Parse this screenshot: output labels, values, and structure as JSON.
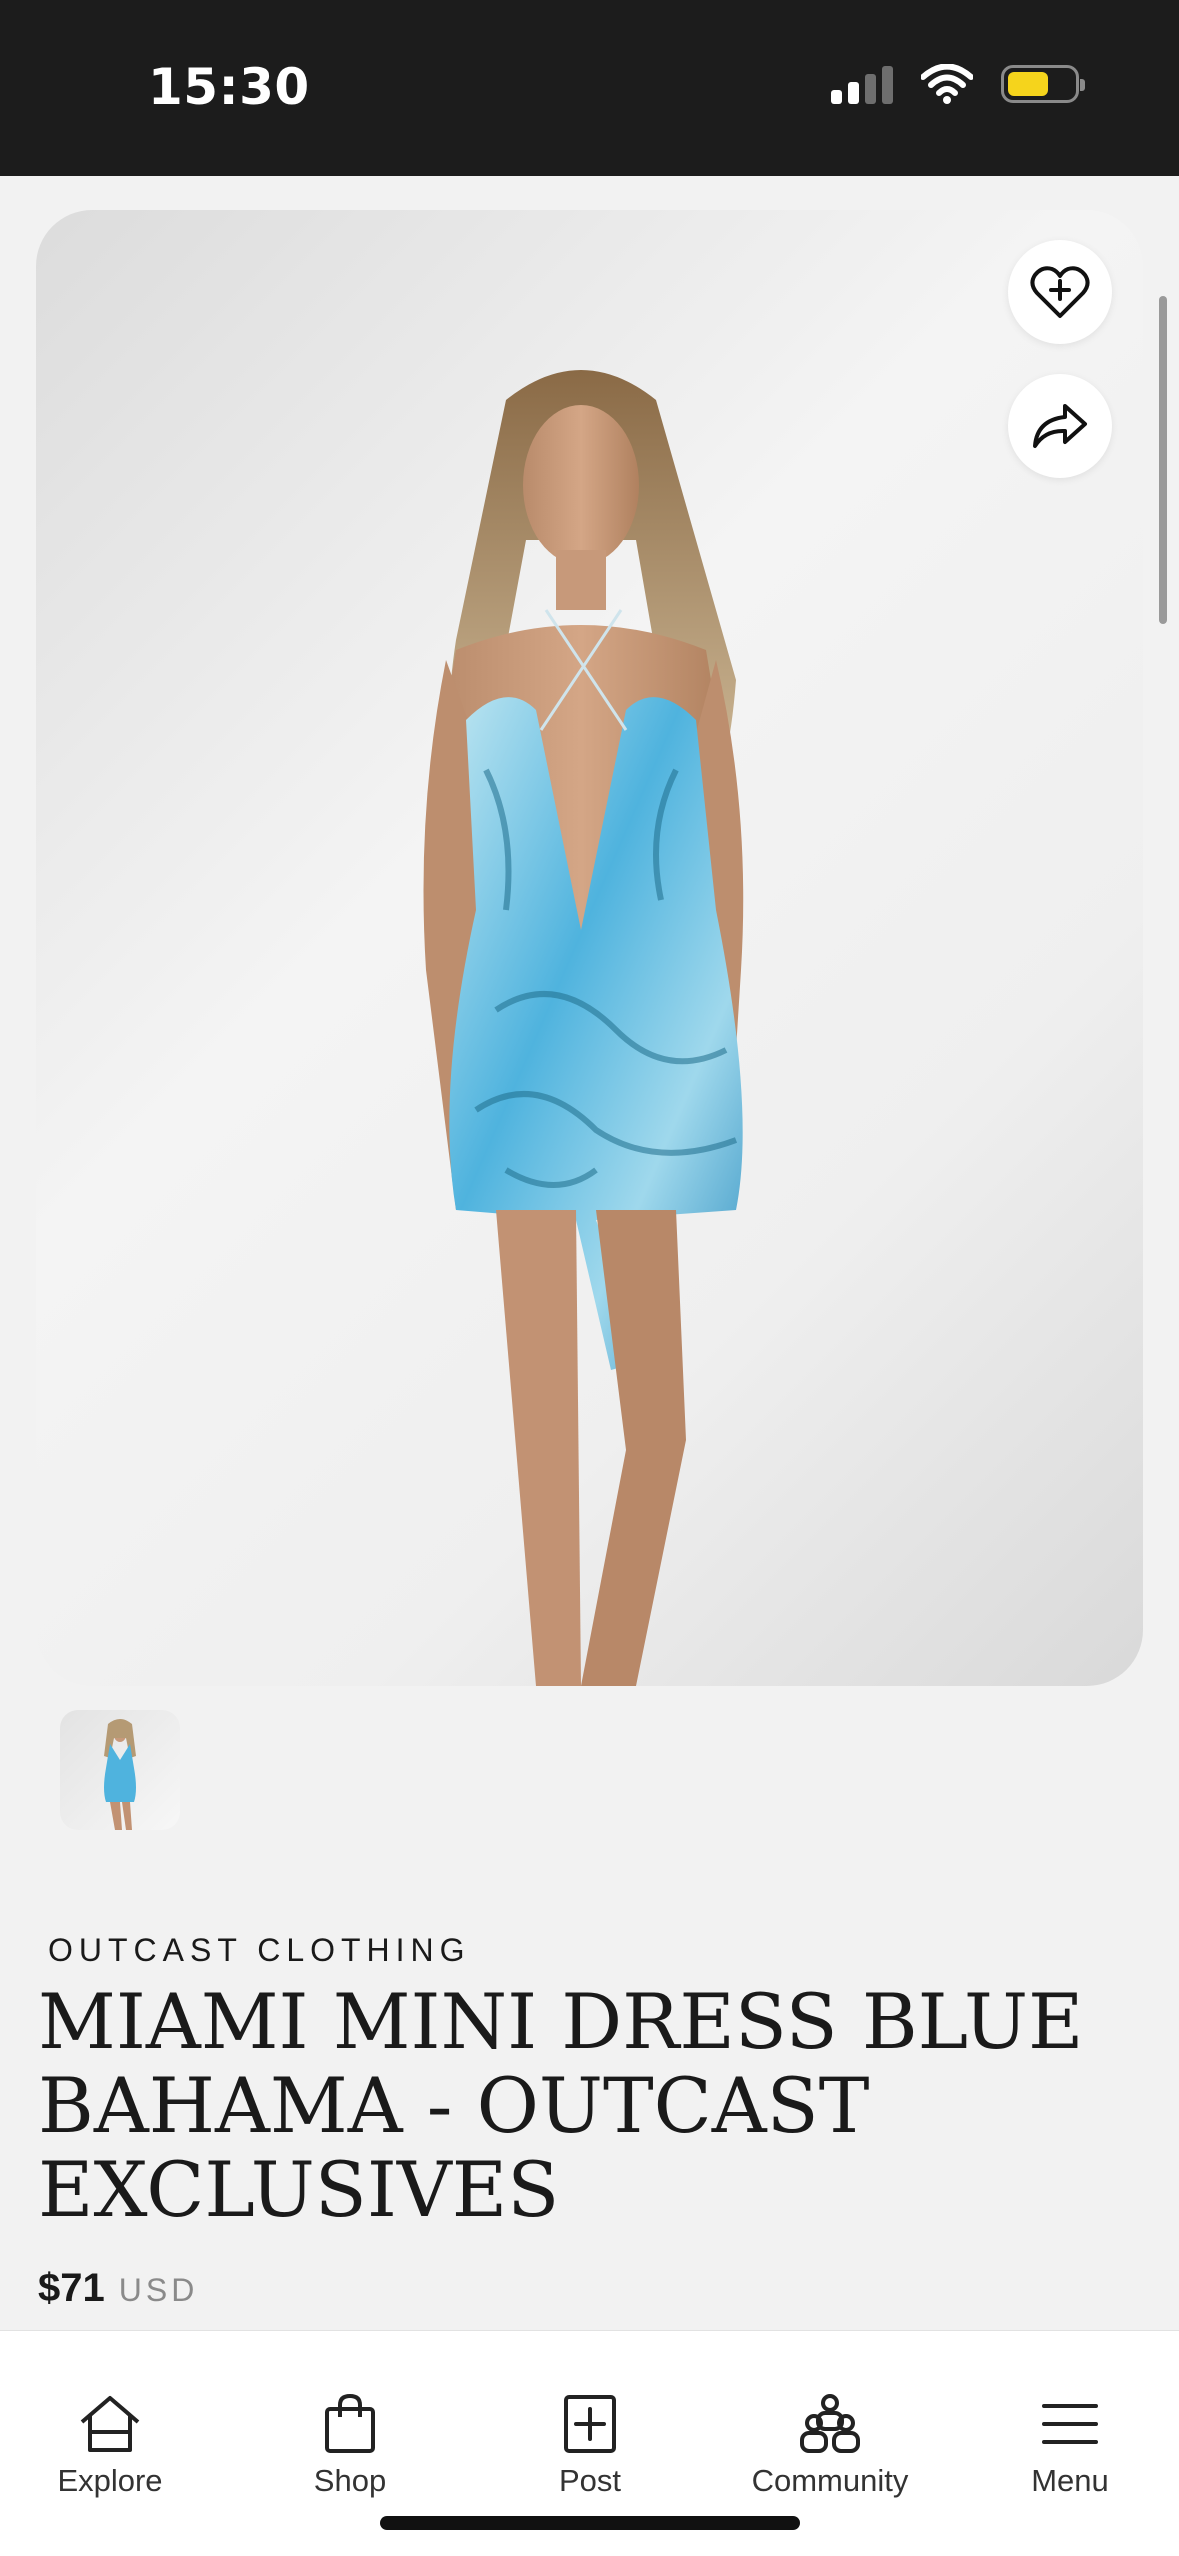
{
  "status_bar": {
    "time": "15:30",
    "icons": [
      "cellular-signal-icon",
      "wifi-icon",
      "battery-icon"
    ],
    "battery_color": "#f5d41c"
  },
  "product": {
    "image_icons": [
      "heart-plus-icon",
      "share-arrow-icon"
    ],
    "brand": "OUTCAST CLOTHING",
    "title": "MIAMI MINI DRESS BLUE BAHAMA - OUTCAST EXCLUSIVES",
    "price": "$71",
    "currency": "USD",
    "dress_color": "#4fb3de"
  },
  "bottom_nav": {
    "items": [
      {
        "label": "Explore",
        "icon": "home-icon"
      },
      {
        "label": "Shop",
        "icon": "shopping-bag-icon"
      },
      {
        "label": "Post",
        "icon": "plus-square-icon"
      },
      {
        "label": "Community",
        "icon": "community-icon"
      },
      {
        "label": "Menu",
        "icon": "hamburger-menu-icon"
      }
    ]
  }
}
